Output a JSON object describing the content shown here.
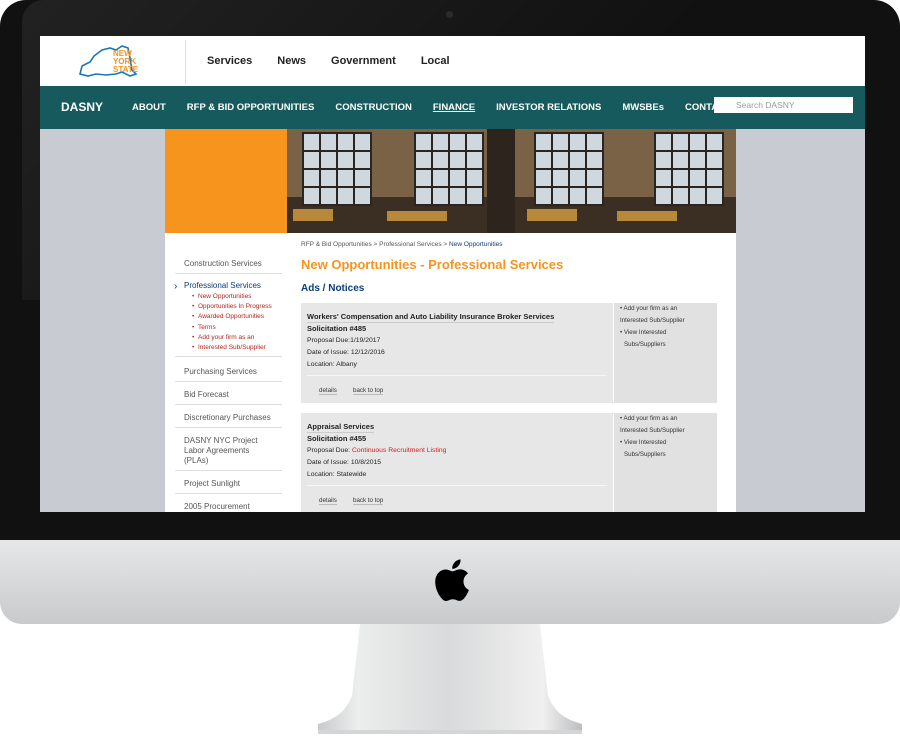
{
  "top_nav": [
    "Services",
    "News",
    "Government",
    "Local"
  ],
  "logo": {
    "line1": "NEW",
    "line2": "YORK",
    "line3": "STATE"
  },
  "main_nav": {
    "brand": "DASNY",
    "items": [
      "ABOUT",
      "RFP & BID OPPORTUNITIES",
      "CONSTRUCTION",
      "FINANCE",
      "INVESTOR RELATIONS",
      "MWSBEs",
      "CONTACT"
    ],
    "search_placeholder": "Search DASNY"
  },
  "sidebar": {
    "construction": "Construction Services",
    "professional": "Professional Services",
    "sub": [
      "New Opportunities",
      "Opportunities In Progress",
      "Awarded Opportunities",
      "Terms",
      "Add your firm as an",
      "Interested Sub/Supplier"
    ],
    "purchasing": "Purchasing Services",
    "bid_forecast": "Bid Forecast",
    "discretionary": "Discretionary Purchases",
    "pla_1": "DASNY NYC Project",
    "pla_2": "Labor Agreements",
    "pla_3": "(PLAs)",
    "sunlight": "Project Sunlight",
    "procurement": "2005 Procurement"
  },
  "breadcrumb": {
    "part1": "RFP & Bid Opportunities",
    "sep": " > ",
    "part2": "Professional Services",
    "part3": "New Opportunities"
  },
  "title": "New Opportunities - Professional Services",
  "section": "Ads / Notices",
  "listings": [
    {
      "title": "Workers' Compensation and Auto Liability Insurance Broker Services",
      "solicitation": "Solicitation #485",
      "proposal_label": "Proposal Due:",
      "proposal_value": "1/19/2017",
      "issue": "Date of Issue: 12/12/2016",
      "location": "Location: Albany",
      "details": "details",
      "back": "back to top",
      "add_1": "• Add your firm as an",
      "add_2": "Interested Sub/Supplier",
      "view_1": "• View Interested",
      "view_2": "Subs/Suppliers"
    },
    {
      "title": "Appraisal Services",
      "solicitation": "Solicitation #455",
      "proposal_label": "Proposal Due: ",
      "proposal_value": "Continuous Recruitment Listing",
      "issue": "Date of Issue: 10/8/2015",
      "location": "Location: Statewide",
      "details": "details",
      "back": "back to top",
      "add_1": "• Add your firm as an",
      "add_2": "Interested Sub/Supplier",
      "view_1": "• View Interested",
      "view_2": "Subs/Suppliers"
    }
  ],
  "colors": {
    "accent_orange": "#f7941d",
    "nav_teal": "#165a5d",
    "link_blue": "#0a3d7a",
    "alert_red": "#d2201a"
  }
}
